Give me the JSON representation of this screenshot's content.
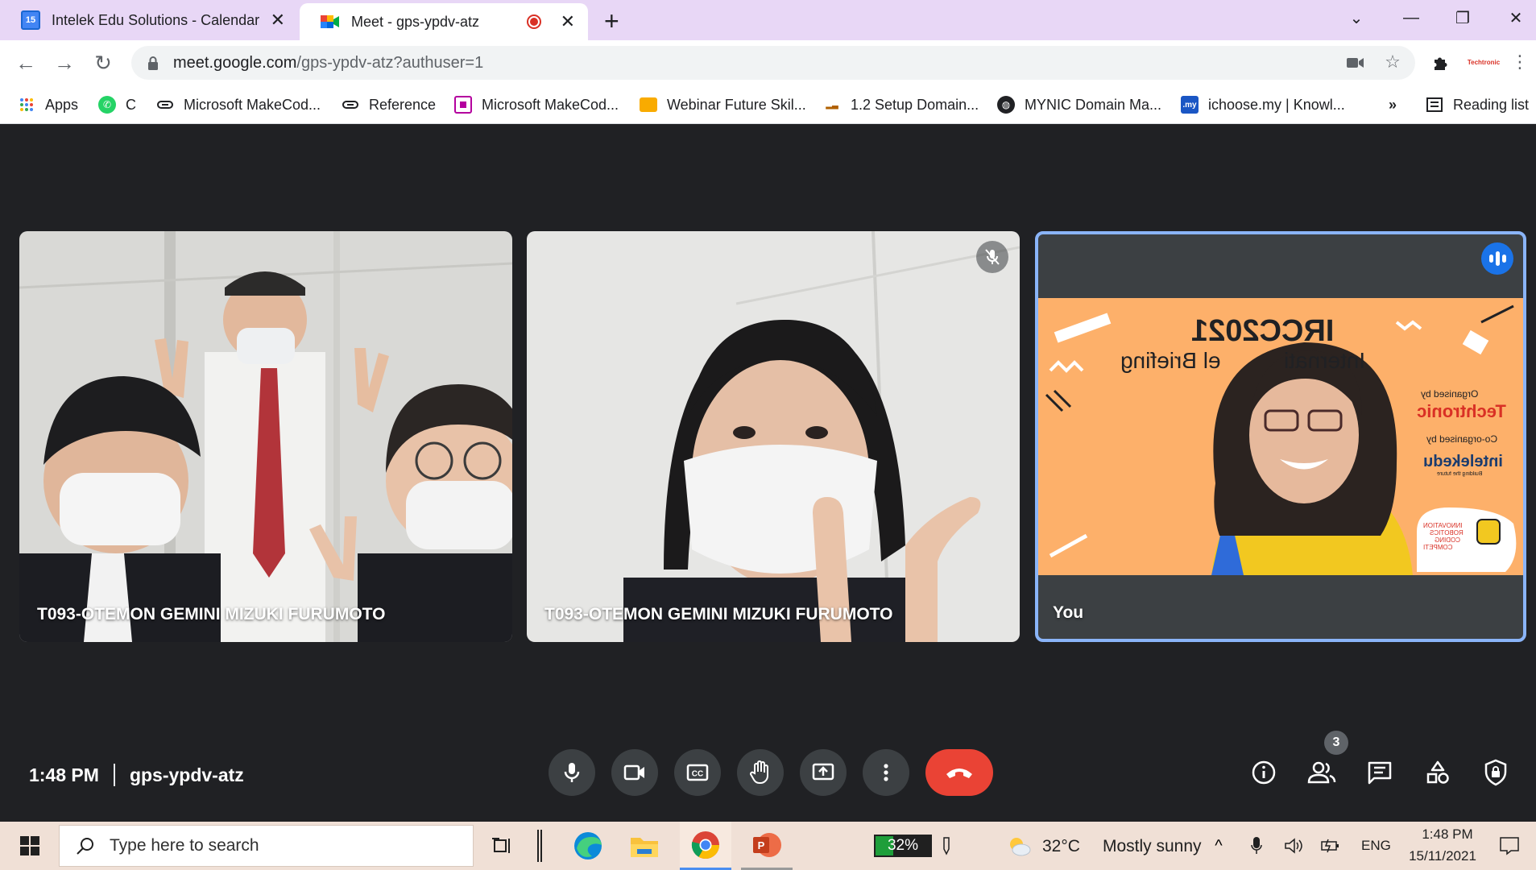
{
  "browser": {
    "tabs": [
      {
        "title": "Intelek Edu Solutions - Calendar",
        "favicon": "calendar-15-icon",
        "favicon_text": "15"
      },
      {
        "title": "Meet - gps-ypdv-atz",
        "favicon": "google-meet-icon",
        "recording": true
      }
    ],
    "address": {
      "host": "meet.google.com",
      "path": "/gps-ypdv-atz?authuser=1"
    },
    "profile_label": "Techtronic"
  },
  "bookmarks": {
    "items": [
      {
        "label": "Apps",
        "icon": "apps-grid-icon"
      },
      {
        "label": "C",
        "icon": "whatsapp-icon"
      },
      {
        "label": "Microsoft MakeCod...",
        "icon": "link-icon"
      },
      {
        "label": "Reference",
        "icon": "link-icon"
      },
      {
        "label": "Microsoft MakeCod...",
        "icon": "makecode-icon"
      },
      {
        "label": "Webinar Future Skil...",
        "icon": "folder-icon"
      },
      {
        "label": "1.2 Setup Domain...",
        "icon": "site-icon"
      },
      {
        "label": "MYNIC Domain Ma...",
        "icon": "globe-icon"
      },
      {
        "label": "ichoose.my | Knowl...",
        "icon": "my-icon"
      }
    ],
    "more": "»",
    "reading_list": "Reading list"
  },
  "meet": {
    "tiles": [
      {
        "name": "T093-OTEMON GEMINI MIZUKI FURUMOTO",
        "muted": false
      },
      {
        "name": "T093-OTEMON GEMINI MIZUKI FURUMOTO",
        "muted": true
      },
      {
        "name": "You",
        "speaking": true
      }
    ],
    "slide": {
      "title": "IRCC2021",
      "subtitle_left": "Internati",
      "subtitle_right": "el Briefing",
      "organised_by": "Organised by",
      "organiser": "Techtronic",
      "co_organised_by": "Co-organised by",
      "co_organiser": "intelekedu",
      "tagline": "Building the future",
      "badge_lines": [
        "INNOVATION",
        "ROBOTICS",
        "CODING",
        "COMPETI"
      ]
    },
    "time": "1:48 PM",
    "meeting_code": "gps-ypdv-atz",
    "participant_count": "3",
    "controls": [
      "microphone",
      "camera",
      "captions",
      "raise-hand",
      "present",
      "more-options",
      "leave-call"
    ],
    "right_controls": [
      "info",
      "people",
      "chat",
      "activities",
      "host-controls"
    ],
    "colors": {
      "stage": "#202124",
      "control": "#3c4043",
      "end_call": "#ea4335",
      "speaking": "#1a73e8",
      "self_border": "#8ab4f8"
    }
  },
  "taskbar": {
    "search_placeholder": "Type here to search",
    "battery": "32%",
    "weather": {
      "temp": "32°C",
      "condition": "Mostly sunny"
    },
    "lang": "ENG",
    "time": "1:48 PM",
    "date": "15/11/2021"
  }
}
